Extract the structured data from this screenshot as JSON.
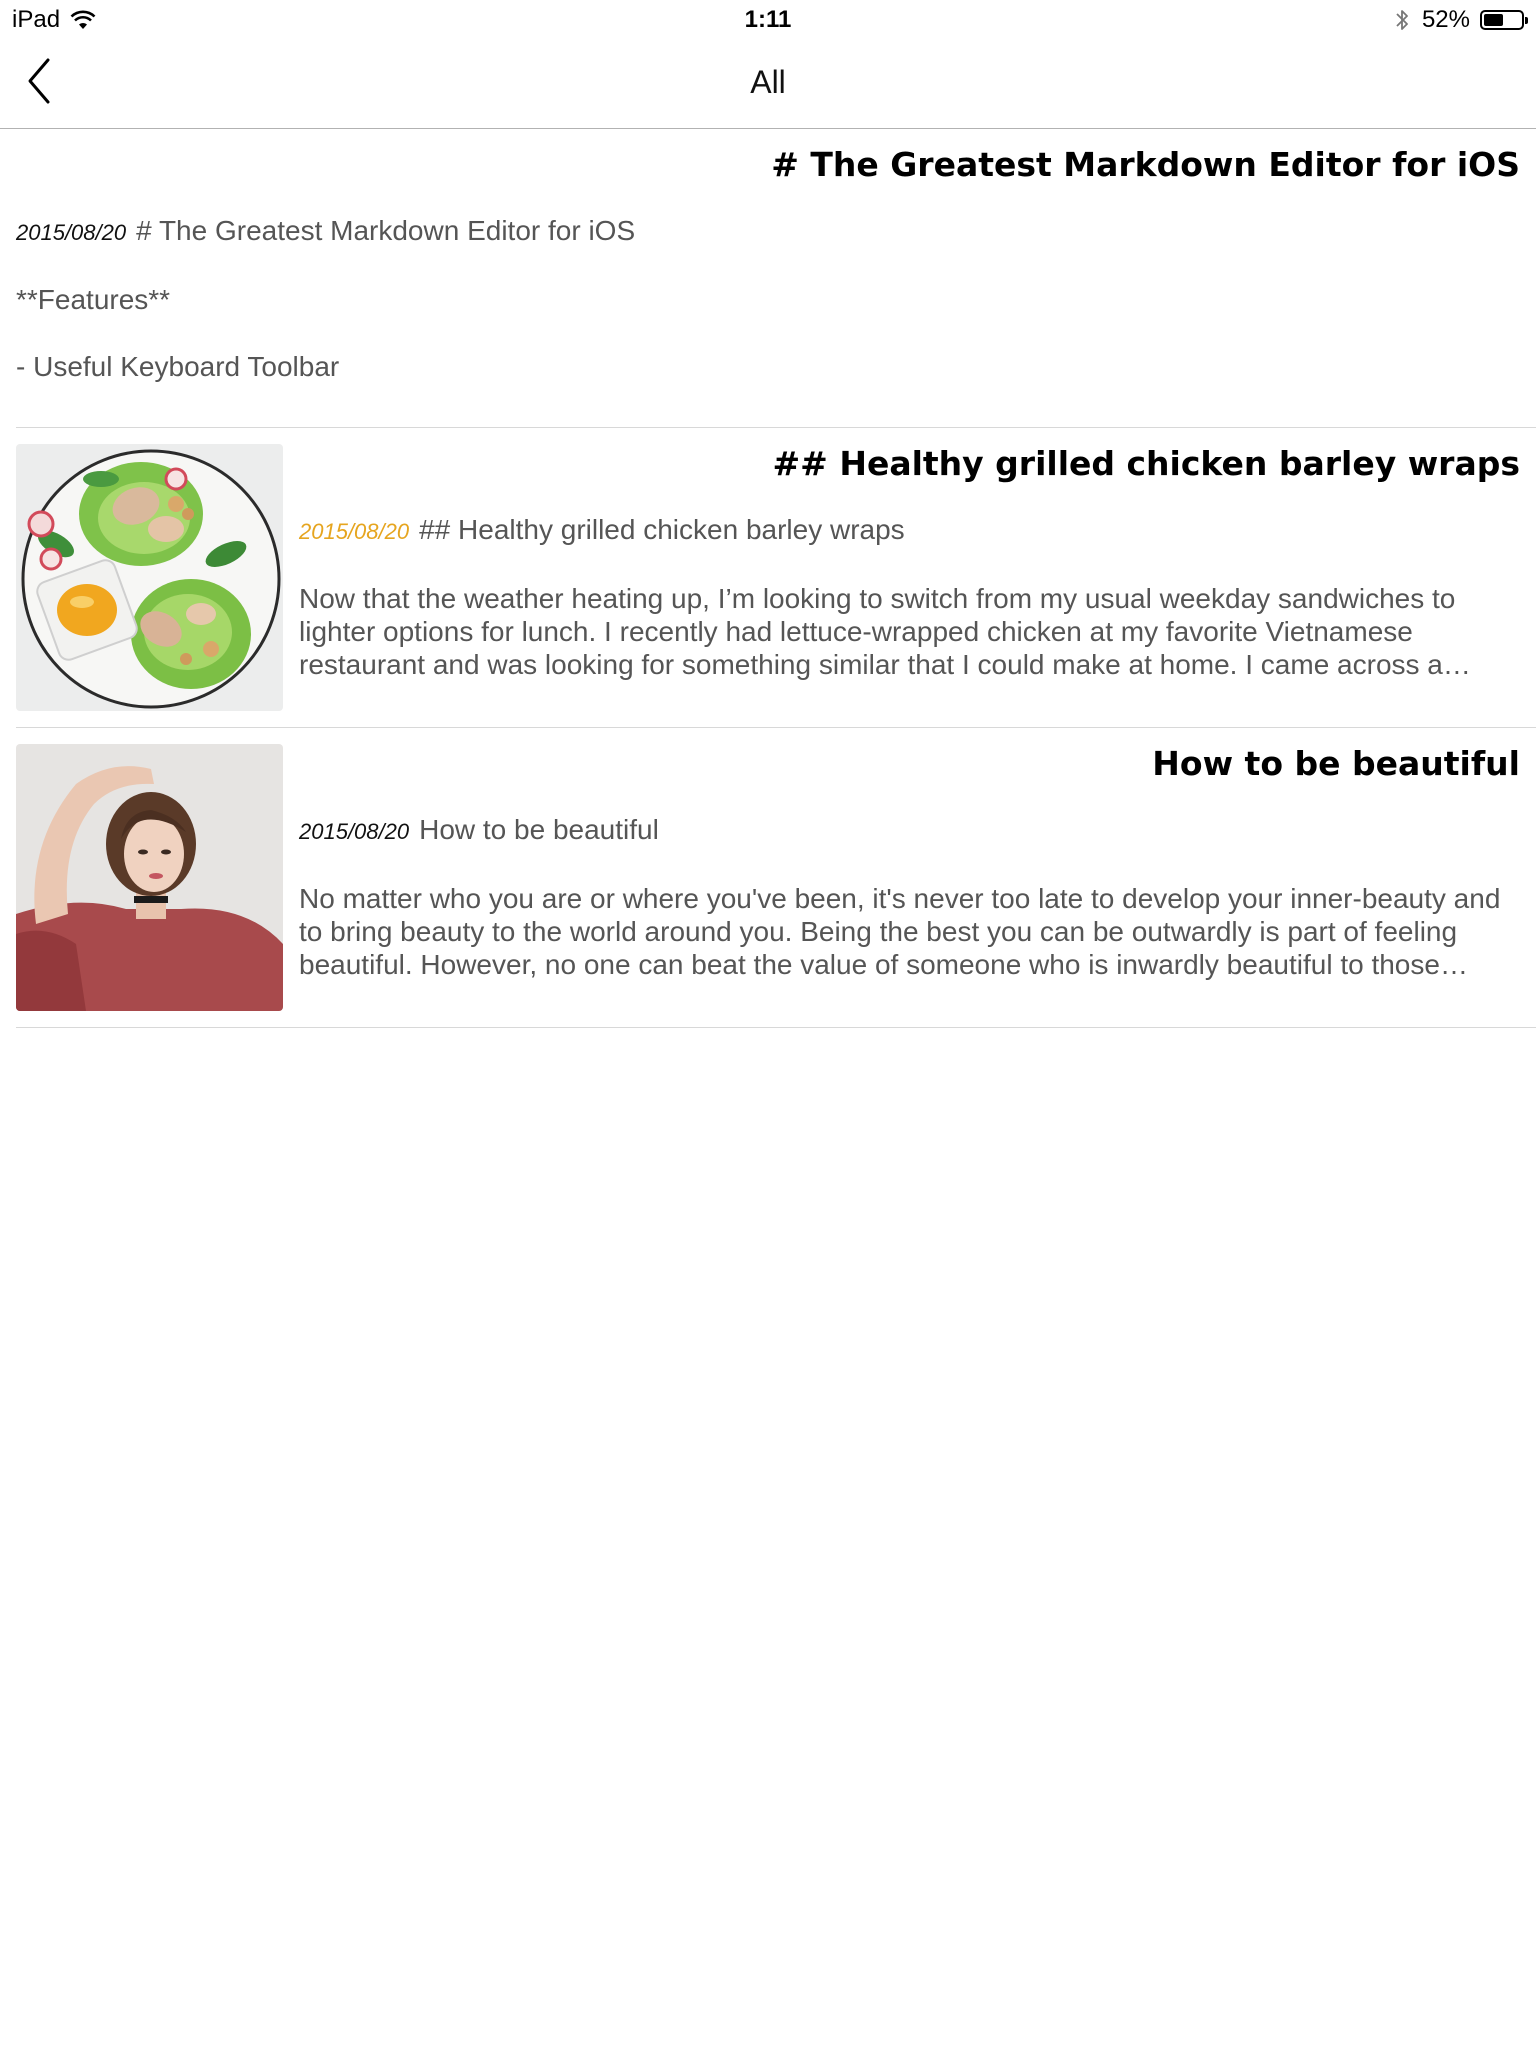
{
  "status_bar": {
    "device": "iPad",
    "time": "1:11",
    "battery_text": "52%",
    "battery_level": 0.52,
    "icons": [
      "wifi-icon",
      "bluetooth-icon",
      "battery-icon"
    ]
  },
  "nav": {
    "title": "All",
    "back_icon": "chevron-left-icon"
  },
  "colors": {
    "accent_date": "#e6a51f",
    "body_text": "#555555",
    "separator": "#d8d8d8"
  },
  "items": [
    {
      "title": "# The Greatest Markdown Editor for iOS",
      "date": "2015/08/20",
      "first_line": "# The Greatest Markdown Editor for iOS",
      "lines": [
        "**Features**",
        "- Useful Keyboard Toolbar"
      ]
    },
    {
      "title": "## Healthy grilled chicken barley wraps",
      "date": "2015/08/20",
      "first_line": "## Healthy grilled chicken barley wraps",
      "excerpt": "Now that the weather heating up, I’m looking to switch from my usual weekday sandwiches to lighter options for lunch. I recently had lettuce-wrapped chicken at my favorite Vietnamese restaurant and was looking for something similar that I could make at home. I came across a recipe for grilled chicken barley wraps that looked delicious.",
      "thumbnail": "food-photo"
    },
    {
      "title": "How to be beautiful",
      "date": "2015/08/20",
      "first_line": "How to be beautiful",
      "excerpt": "No matter who you are or where you've been, it's never too late to develop your inner-beauty and to bring beauty to the world around you. Being the best you can be outwardly is part of feeling beautiful. However, no one can beat the value of someone who is inwardly beautiful to those around them.",
      "thumbnail": "portrait-photo"
    }
  ]
}
